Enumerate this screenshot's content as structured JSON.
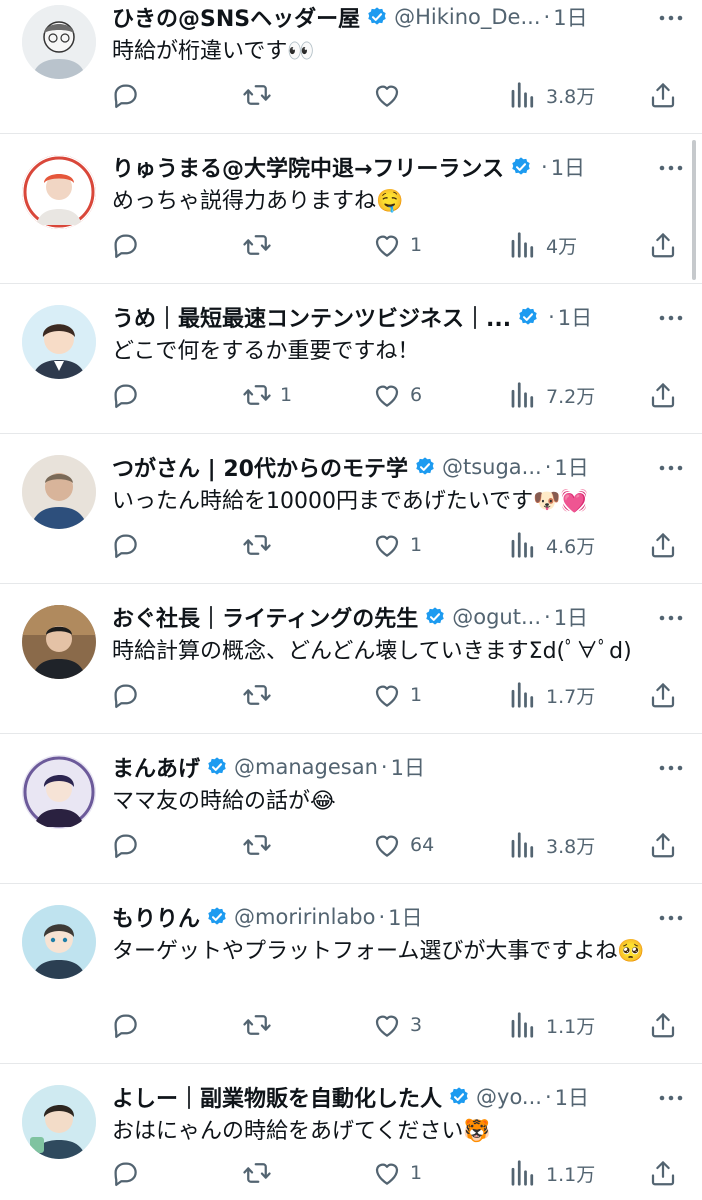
{
  "colors": {
    "verified": "#1d9bf0",
    "text": "#0f1419",
    "muted": "#536471"
  },
  "icons": {
    "reply": "reply-icon",
    "retweet": "retweet-icon",
    "like": "heart-icon",
    "views": "views-icon",
    "share": "share-icon",
    "more": "more-icon",
    "verified": "verified-badge-icon"
  },
  "tweets": [
    {
      "name": "ひきの@SNSヘッダー屋",
      "handle": "@Hikino_De...",
      "dot": "·",
      "time": "1日",
      "text": "時給が桁違いです👀",
      "replies": "",
      "retweets": "",
      "likes": "",
      "views": "3.8万"
    },
    {
      "name": "りゅうまる@大学院中退→フリーランス",
      "handle": "",
      "dot": "·",
      "time": "1日",
      "text": "めっちゃ説得力ありますね🤤",
      "replies": "",
      "retweets": "",
      "likes": "1",
      "views": "4万"
    },
    {
      "name": "うめ｜最短最速コンテンツビジネス｜...",
      "handle": "",
      "dot": "·",
      "time": "1日",
      "text": "どこで何をするか重要ですね！",
      "replies": "",
      "retweets": "1",
      "likes": "6",
      "views": "7.2万"
    },
    {
      "name": "つがさん | 20代からのモテ学",
      "handle": "@tsuga...",
      "dot": "·",
      "time": "1日",
      "text": "いったん時給を10000円まであげたいです🐶💓",
      "replies": "",
      "retweets": "",
      "likes": "1",
      "views": "4.6万"
    },
    {
      "name": "おぐ社長｜ライティングの先生",
      "handle": "@ogut...",
      "dot": "·",
      "time": "1日",
      "text": "時給計算の概念、どんどん壊していきますΣd(ﾟ∀ﾟd)",
      "replies": "",
      "retweets": "",
      "likes": "1",
      "views": "1.7万"
    },
    {
      "name": "まんあげ",
      "handle": "@managesan",
      "dot": "·",
      "time": "1日",
      "text": "ママ友の時給の話が😂",
      "replies": "",
      "retweets": "",
      "likes": "64",
      "views": "3.8万"
    },
    {
      "name": "もりりん",
      "handle": "@moririnlabo",
      "dot": "·",
      "time": "1日",
      "text": "ターゲットやプラットフォーム選びが大事ですよね🥺",
      "replies": "",
      "retweets": "",
      "likes": "3",
      "views": "1.1万"
    },
    {
      "name": "よしー｜副業物販を自動化した人",
      "handle": "@yo...",
      "dot": "·",
      "time": "1日",
      "text": "おはにゃんの時給をあげてください🐯",
      "replies": "",
      "retweets": "",
      "likes": "1",
      "views": "1.1万"
    }
  ]
}
